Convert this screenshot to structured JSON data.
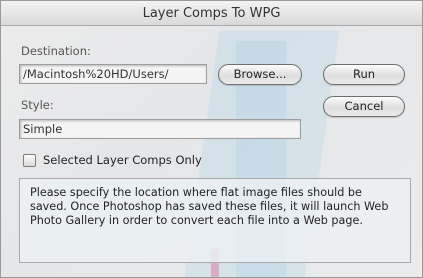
{
  "dialog": {
    "title": "Layer Comps To WPG"
  },
  "destination": {
    "label": "Destination:",
    "value": "/Macintosh%20HD/Users/",
    "browse_label": "Browse..."
  },
  "style": {
    "label": "Style:",
    "value": "Simple"
  },
  "buttons": {
    "run_label": "Run",
    "cancel_label": "Cancel"
  },
  "options": {
    "selected_only_label": "Selected Layer Comps Only",
    "selected_only_checked": false
  },
  "info": {
    "text": "Please specify the location where flat image files should be saved. Once Photoshop has saved these files, it will launch Web Photo Gallery in order to convert each file into a Web page."
  }
}
